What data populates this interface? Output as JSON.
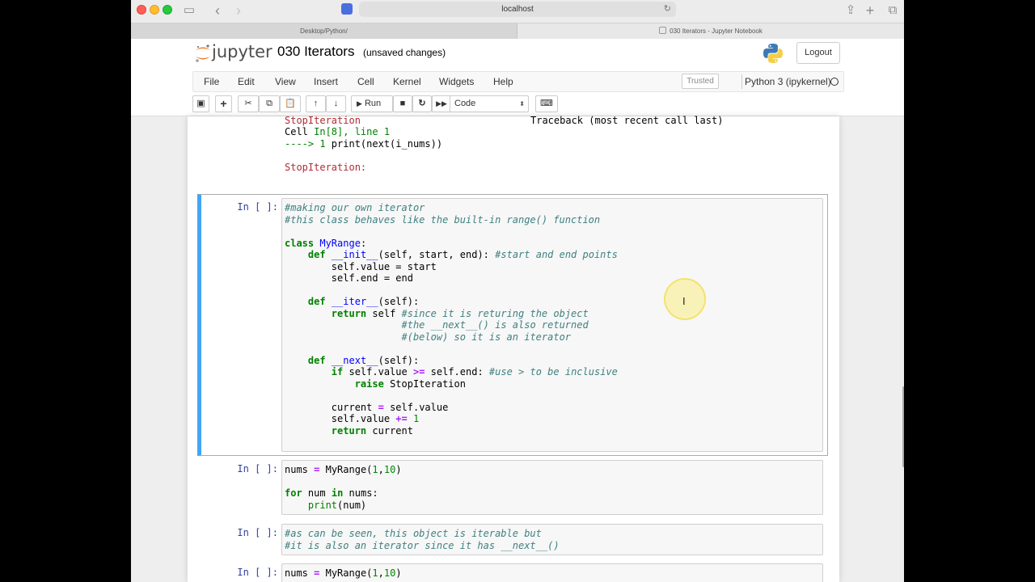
{
  "browser": {
    "address": "localhost",
    "tabs": [
      "Desktop/Python/",
      "030 Iterators - Jupyter Notebook"
    ]
  },
  "jupyter": {
    "logo_text": "jupyter",
    "notebook_title": "030 Iterators",
    "save_status": "(unsaved changes)",
    "logout_label": "Logout",
    "menu": [
      "File",
      "Edit",
      "View",
      "Insert",
      "Cell",
      "Kernel",
      "Widgets",
      "Help"
    ],
    "trusted_label": "Trusted",
    "kernel_name": "Python 3 (ipykernel)",
    "run_label": "Run",
    "cell_type": "Code"
  },
  "traceback": {
    "error_name": "StopIteration",
    "traceback_header": "Traceback (most recent call last)",
    "cell_ref": "Cell ",
    "cell_ref_loc": "In[8], line 1",
    "arrow_line_prefix": "----> 1 ",
    "arrow_line_code": "print(next(i_nums))",
    "final_error": "StopIteration:"
  },
  "cells": {
    "prompt": "In [ ]:",
    "cell1": {
      "comment1": "#making our own iterator",
      "comment2": "#this class behaves like the built-in range() function",
      "class_kw": "class",
      "class_name": "MyRange",
      "def_kw": "def",
      "init_name": "__init__",
      "init_args": "(self, start, end):",
      "init_comment": "#start and end points",
      "line_value": "self.value = start",
      "line_end": "self.end = end",
      "iter_name": "__iter__",
      "iter_args": "(self):",
      "return_kw": "return",
      "return_self": "self",
      "iter_comment1": "#since it is returing the object",
      "iter_comment2": "#the __next__() is also returned",
      "iter_comment3": "#(below) so it is an iterator",
      "next_name": "__next__",
      "next_args": "(self):",
      "if_kw": "if",
      "if_cond_a": "self.value",
      "if_op": ">=",
      "if_cond_b": "self.end:",
      "if_comment": "#use > to be inclusive",
      "raise_kw": "raise",
      "raise_what": "StopIteration",
      "current_line_a": "current",
      "current_line_b": "self.value",
      "incr_a": "self.value",
      "incr_op": "+=",
      "incr_b": "1",
      "return_current": "current"
    },
    "cell2": {
      "line1_a": "nums",
      "line1_b": "MyRange(",
      "line1_n1": "1",
      "line1_n2": "10",
      "for_kw": "for",
      "for_var": "num",
      "in_kw": "in",
      "for_iter": "nums:",
      "print_fn": "print",
      "print_arg": "(num)"
    },
    "cell3": {
      "comment1": "#as can be seen, this object is iterable but",
      "comment2": "#it is also an iterator since it has __next__()"
    },
    "cell4": {
      "line1_a": "nums",
      "line1_b": "MyRange(",
      "line1_n1": "1",
      "line1_n2": "10"
    }
  }
}
